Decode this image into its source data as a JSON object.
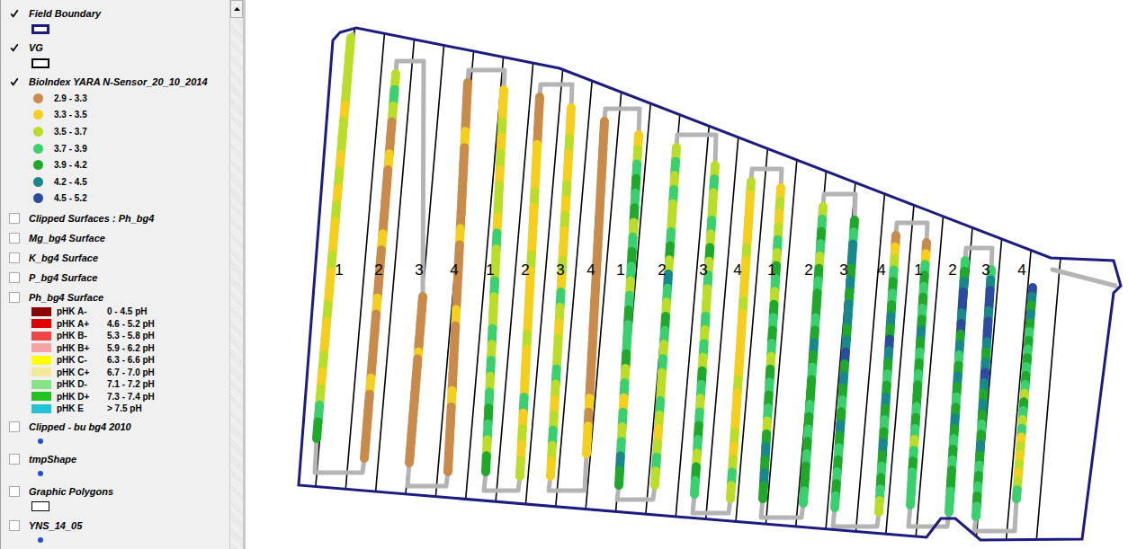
{
  "layers": [
    {
      "name": "Field Boundary",
      "checked": true,
      "kind": "outline",
      "color": "#1c1c80"
    },
    {
      "name": "VG",
      "checked": true,
      "kind": "outline",
      "color": "#000000"
    },
    {
      "name": "BioIndex YARA N-Sensor_20_10_2014",
      "checked": true,
      "kind": "points",
      "classes": [
        {
          "label": "2.9 - 3.3",
          "color": "#c98b4c"
        },
        {
          "label": "3.3 - 3.5",
          "color": "#f5cf1f"
        },
        {
          "label": "3.5 - 3.7",
          "color": "#b9dd2a"
        },
        {
          "label": "3.7 - 3.9",
          "color": "#3ccf6e"
        },
        {
          "label": "3.9 - 4.2",
          "color": "#1fa82c"
        },
        {
          "label": "4.2 - 4.5",
          "color": "#19888a"
        },
        {
          "label": "4.5 - 5.2",
          "color": "#2b4c9c"
        }
      ]
    },
    {
      "name": "Clipped Surfaces : Ph_bg4",
      "checked": false,
      "kind": "plain"
    },
    {
      "name": "Mg_bg4 Surface",
      "checked": false,
      "kind": "plain"
    },
    {
      "name": "K_bg4 Surface",
      "checked": false,
      "kind": "plain"
    },
    {
      "name": "P_bg4 Surface",
      "checked": false,
      "kind": "plain"
    },
    {
      "name": "Ph_bg4 Surface",
      "checked": false,
      "kind": "surface",
      "classes": [
        {
          "code": "pHK A-",
          "range": "0 - 4.5 pH",
          "color": "#8b0000"
        },
        {
          "code": "pHK A+",
          "range": "4.6 - 5.2 pH",
          "color": "#e00000"
        },
        {
          "code": "pHK B-",
          "range": "5.3 - 5.8 pH",
          "color": "#f04646"
        },
        {
          "code": "pHK B+",
          "range": "5.9 - 6.2 pH",
          "color": "#f5a3a3"
        },
        {
          "code": "pHK C-",
          "range": "6.3 - 6.6 pH",
          "color": "#ffff00"
        },
        {
          "code": "pHK C+",
          "range": "6.7 - 7.0 pH",
          "color": "#f2ea96"
        },
        {
          "code": "pHK D-",
          "range": "7.1 - 7.2 pH",
          "color": "#86e486"
        },
        {
          "code": "pHK D+",
          "range": "7.3 - 7.4 pH",
          "color": "#22c222"
        },
        {
          "code": "pHK E",
          "range": "> 7.5 pH",
          "color": "#22c3d3"
        }
      ]
    },
    {
      "name": "Clipped - bu bg4 2010",
      "checked": false,
      "kind": "dot",
      "color": "#1f4fd8"
    },
    {
      "name": "tmpShape",
      "checked": false,
      "kind": "dot",
      "color": "#1f4fd8"
    },
    {
      "name": "Graphic Polygons",
      "checked": false,
      "kind": "outline",
      "color": "#000000"
    },
    {
      "name": "YNS_14_05",
      "checked": false,
      "kind": "dot",
      "color": "#1f4fd8"
    }
  ],
  "map": {
    "strip_labels": [
      "1",
      "2",
      "3",
      "4",
      "1",
      "2",
      "3",
      "4",
      "1",
      "2",
      "3",
      "4",
      "1",
      "2",
      "3",
      "4",
      "1",
      "2",
      "3",
      "4"
    ],
    "tracks": [
      {
        "values": [
          3.6,
          3.6,
          3.5,
          3.6,
          3.4,
          3.6,
          3.5,
          3.4,
          3.6,
          3.4,
          3.5,
          3.4,
          3.4,
          3.6,
          3.4,
          3.4,
          3.5,
          3.4,
          3.4,
          3.6,
          3.4,
          3.6,
          3.8,
          3.9
        ]
      },
      {
        "values": [
          3.6,
          3.8,
          3.6,
          3.1,
          3.1,
          3.4,
          3.1,
          3.1,
          3.2,
          3.1,
          3.4,
          3.1,
          3.1,
          3.1,
          3.4,
          3.1,
          3.1,
          3.2,
          3.1,
          3.4,
          3.1,
          3.1,
          3.1,
          3.1
        ]
      },
      {
        "values": [
          3.1,
          3.1,
          3.1,
          3.1,
          3.1,
          3.1,
          3.1,
          3.1,
          3.4,
          3.1,
          3.1,
          3.1,
          3.1,
          3.1,
          3.1,
          3.1,
          3.1,
          3.1,
          3.1,
          3.1,
          3.1,
          3.1,
          3.1,
          3.1
        ]
      },
      {
        "values": [
          3.1,
          3.1,
          3.1,
          3.4,
          3.1,
          3.1,
          3.1,
          3.1,
          3.1,
          3.4,
          3.1,
          3.1,
          3.1,
          3.1,
          3.4,
          3.1,
          3.1,
          3.1,
          3.1,
          3.4,
          3.1,
          3.1,
          3.1,
          3.1
        ]
      },
      {
        "values": [
          3.4,
          3.4,
          3.6,
          3.4,
          3.6,
          3.4,
          3.6,
          3.6,
          3.4,
          3.8,
          3.6,
          3.6,
          3.8,
          3.6,
          3.6,
          3.8,
          3.6,
          3.8,
          3.6,
          3.8,
          4.0,
          3.8,
          3.6,
          4.0
        ]
      },
      {
        "values": [
          3.1,
          3.1,
          3.1,
          3.4,
          3.4,
          3.4,
          3.6,
          3.4,
          3.4,
          3.4,
          3.6,
          3.4,
          3.4,
          3.4,
          3.4,
          3.6,
          3.4,
          3.4,
          3.4,
          3.8,
          3.4,
          3.6,
          3.4,
          3.6
        ]
      },
      {
        "values": [
          3.4,
          3.4,
          3.6,
          3.4,
          3.4,
          3.6,
          3.4,
          3.6,
          3.4,
          3.4,
          3.6,
          3.4,
          3.8,
          3.6,
          3.4,
          3.6,
          3.6,
          3.8,
          3.6,
          3.4,
          3.6,
          3.8,
          3.6,
          3.4
        ]
      },
      {
        "values": [
          3.1,
          3.1,
          3.1,
          3.1,
          3.1,
          3.1,
          3.1,
          3.1,
          3.1,
          3.1,
          3.1,
          3.1,
          3.1,
          3.1,
          3.1,
          3.1,
          3.1,
          3.1,
          3.1,
          3.1,
          3.4,
          3.1,
          3.4,
          3.4
        ]
      },
      {
        "values": [
          3.4,
          3.6,
          3.8,
          4.0,
          3.8,
          4.0,
          3.6,
          3.8,
          4.0,
          3.8,
          3.6,
          3.8,
          4.0,
          3.8,
          3.8,
          4.0,
          3.6,
          3.8,
          3.4,
          3.8,
          3.6,
          3.8,
          4.3,
          4.0
        ]
      },
      {
        "values": [
          3.6,
          3.8,
          3.6,
          3.8,
          3.6,
          3.6,
          3.8,
          4.0,
          3.6,
          4.3,
          3.8,
          3.6,
          4.0,
          3.8,
          3.6,
          3.8,
          3.6,
          3.6,
          3.8,
          3.6,
          3.4,
          3.6,
          3.8,
          3.6
        ]
      },
      {
        "values": [
          3.6,
          3.8,
          3.6,
          3.6,
          3.8,
          3.6,
          4.0,
          3.6,
          3.8,
          3.6,
          3.6,
          3.8,
          3.6,
          3.8,
          3.6,
          4.0,
          3.8,
          3.6,
          3.8,
          4.0,
          3.8,
          3.6,
          4.0,
          3.8
        ]
      },
      {
        "values": [
          3.6,
          3.4,
          3.4,
          3.4,
          3.4,
          3.6,
          3.4,
          3.4,
          3.4,
          3.6,
          3.4,
          3.4,
          3.4,
          3.4,
          3.4,
          3.6,
          3.4,
          3.4,
          3.4,
          3.6,
          3.4,
          3.6,
          3.8,
          3.6
        ]
      },
      {
        "values": [
          3.4,
          3.6,
          3.4,
          3.6,
          3.8,
          3.6,
          4.0,
          3.8,
          3.6,
          4.0,
          3.8,
          4.0,
          3.8,
          3.6,
          4.0,
          3.8,
          4.0,
          3.8,
          3.6,
          4.0,
          4.3,
          4.0,
          4.3,
          4.0
        ]
      },
      {
        "values": [
          3.6,
          3.8,
          4.0,
          3.8,
          3.6,
          4.0,
          3.8,
          4.0,
          4.0,
          3.8,
          4.0,
          4.3,
          4.0,
          3.8,
          4.0,
          4.0,
          3.8,
          4.0,
          3.8,
          4.0,
          3.8,
          4.0,
          4.0,
          3.8
        ]
      },
      {
        "values": [
          4.0,
          3.8,
          4.3,
          4.3,
          4.0,
          4.3,
          4.0,
          4.3,
          4.3,
          4.0,
          4.3,
          4.8,
          4.0,
          4.3,
          4.0,
          3.8,
          4.0,
          4.3,
          4.0,
          3.8,
          4.0,
          3.8,
          4.0,
          3.8
        ]
      },
      {
        "values": [
          3.1,
          3.4,
          3.6,
          3.8,
          4.0,
          3.8,
          4.0,
          4.3,
          4.0,
          4.8,
          4.3,
          4.0,
          3.8,
          4.0,
          4.3,
          4.0,
          3.8,
          4.0,
          4.3,
          4.0,
          3.8,
          4.0,
          3.8,
          3.6
        ]
      },
      {
        "values": [
          3.1,
          3.4,
          3.8,
          4.0,
          3.8,
          4.0,
          3.8,
          4.0,
          4.3,
          4.0,
          3.8,
          4.0,
          3.8,
          4.0,
          4.0,
          3.8,
          4.0,
          3.8,
          3.6,
          3.8,
          4.0,
          3.8,
          3.8,
          3.8
        ]
      },
      {
        "values": [
          3.8,
          4.0,
          4.3,
          4.8,
          4.8,
          4.3,
          4.8,
          4.0,
          4.3,
          3.8,
          4.0,
          4.3,
          4.0,
          3.8,
          4.0,
          4.3,
          4.0,
          3.8,
          4.0,
          3.8,
          4.0,
          4.0,
          3.8,
          3.8
        ]
      },
      {
        "values": [
          3.8,
          4.3,
          4.8,
          4.8,
          4.3,
          4.8,
          4.8,
          4.3,
          4.0,
          4.3,
          4.8,
          4.3,
          4.0,
          4.3,
          4.0,
          3.8,
          4.0,
          4.3,
          4.0,
          3.8,
          4.0,
          3.8,
          4.0,
          3.8
        ]
      },
      {
        "values": [
          4.8,
          4.3,
          4.0,
          4.3,
          4.0,
          3.8,
          4.0,
          3.8,
          4.0,
          3.8,
          4.0,
          3.8,
          3.6,
          4.0,
          3.8,
          3.6,
          3.8,
          3.4,
          3.6,
          3.4,
          3.6,
          3.4,
          3.6,
          3.8
        ]
      }
    ]
  }
}
